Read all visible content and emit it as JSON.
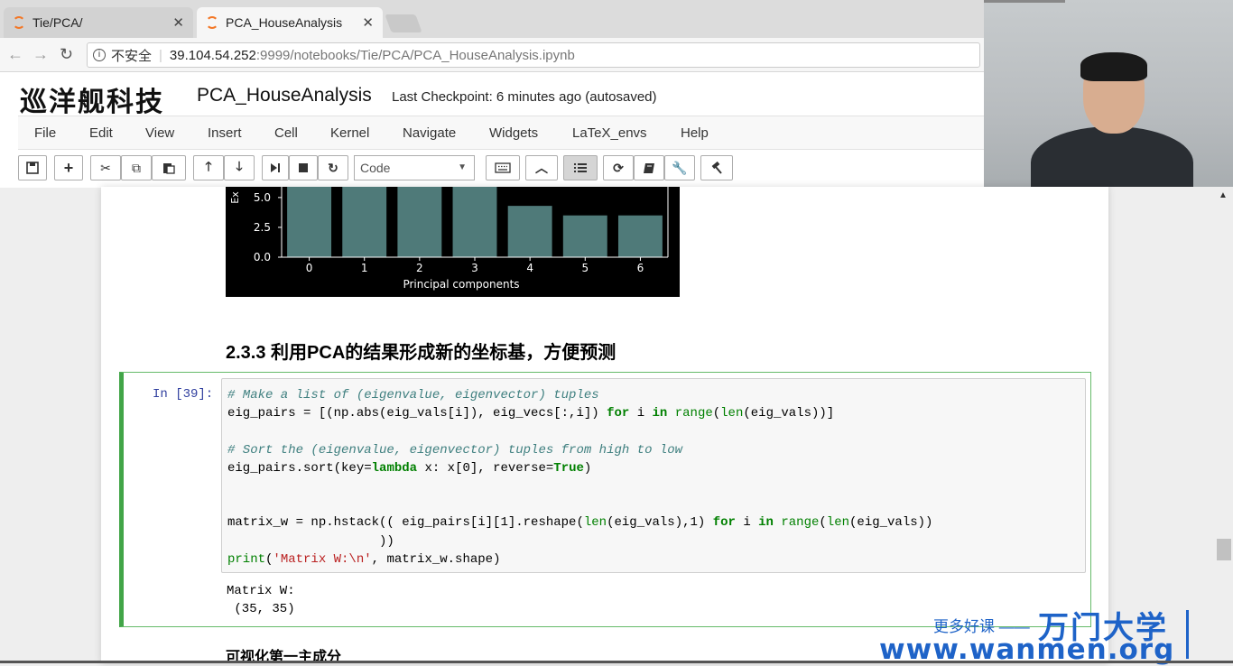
{
  "browser": {
    "tabs": [
      {
        "title": "Tie/PCA/",
        "active": false
      },
      {
        "title": "PCA_HouseAnalysis",
        "active": true
      }
    ],
    "security_label": "不安全",
    "url_host": "39.104.54.252",
    "url_rest": ":9999/notebooks/Tie/PCA/PCA_HouseAnalysis.ipynb"
  },
  "jupyter": {
    "logo_text": "巡洋舰科技",
    "notebook_name": "PCA_HouseAnalysis",
    "checkpoint": "Last Checkpoint: 6 minutes ago (autosaved)",
    "menu": [
      "File",
      "Edit",
      "View",
      "Insert",
      "Cell",
      "Kernel",
      "Navigate",
      "Widgets",
      "LaTeX_envs",
      "Help"
    ],
    "cell_type": "Code"
  },
  "notebook": {
    "heading": "2.3.3  利用PCA的结果形成新的坐标基，方便预测",
    "prompt": "In  [39]:",
    "code_lines": {
      "l1": "# Make a list of (eigenvalue, eigenvector) tuples",
      "l2a": "eig_pairs = [(np.abs(eig_vals[i]), eig_vecs[:,i]) ",
      "l2_for": "for",
      "l2b": " i ",
      "l2_in": "in",
      "l2c": " ",
      "l2_range": "range",
      "l2d": "(",
      "l2_len": "len",
      "l2e": "(eig_vals))]",
      "l4": "# Sort the (eigenvalue, eigenvector) tuples from high to low",
      "l5a": "eig_pairs.sort(key=",
      "l5_lambda": "lambda",
      "l5b": " x: x[0], reverse=",
      "l5_true": "True",
      "l5c": ")",
      "l8a": "matrix_w = np.hstack(( eig_pairs[i][1].reshape(",
      "l8_len": "len",
      "l8b": "(eig_vals),1) ",
      "l8_for": "for",
      "l8c": " i ",
      "l8_in": "in",
      "l8d": " ",
      "l8_range": "range",
      "l8e": "(",
      "l8_len2": "len",
      "l8f": "(eig_vals))",
      "l9": "                    ))",
      "l10_print": "print",
      "l10a": "(",
      "l10_str": "'Matrix W:\\n'",
      "l10b": ", matrix_w.shape)"
    },
    "output_lines": [
      "Matrix W:",
      " (35, 35)"
    ],
    "next_heading": "可视化第一主成分"
  },
  "chart_data": {
    "type": "bar",
    "categories": [
      "0",
      "1",
      "2",
      "3",
      "4",
      "5",
      "6"
    ],
    "values": [
      6.2,
      6.2,
      6.2,
      6.2,
      4.3,
      3.5,
      3.5
    ],
    "yticks": [
      "0.0",
      "2.5",
      "5.0"
    ],
    "ylabel_visible_fragment": "Ex",
    "xlabel": "Principal components",
    "ylim": [
      0,
      6.2
    ],
    "bar_color": "#4f7a79",
    "background": "#000000"
  },
  "watermark": {
    "line1": "更多好课",
    "brand": "万门大学",
    "url": "www.wanmen.org",
    "color": "#1e63c8"
  }
}
